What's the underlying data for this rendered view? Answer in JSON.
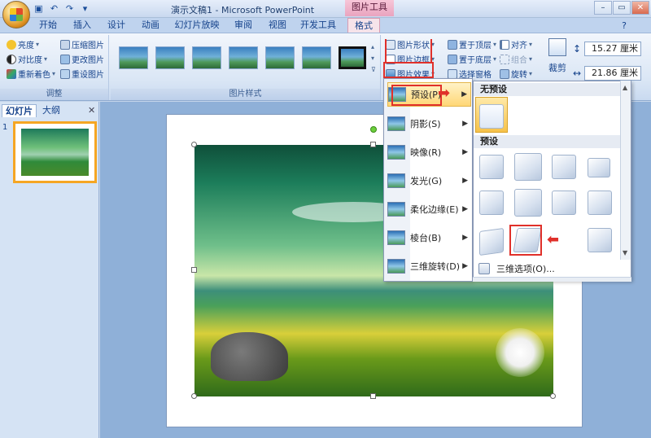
{
  "window": {
    "title": "演示文稿1 - Microsoft PowerPoint",
    "tools_title": "图片工具"
  },
  "tabs": [
    "开始",
    "插入",
    "设计",
    "动画",
    "幻灯片放映",
    "审阅",
    "视图",
    "开发工具",
    "格式"
  ],
  "ribbon": {
    "adjust": {
      "label": "调整",
      "items": [
        "亮度",
        "对比度",
        "重新着色",
        "压缩图片",
        "更改图片",
        "重设图片"
      ]
    },
    "picture_styles": {
      "label": "图片样式",
      "shape": "图片形状",
      "border": "图片边框",
      "effects": "图片效果"
    },
    "arrange": {
      "items": [
        "置于顶层",
        "置于底层",
        "选择窗格",
        "对齐",
        "组合",
        "旋转"
      ]
    },
    "size": {
      "crop": "裁剪",
      "height": "15.27 厘米",
      "width": "21.86 厘米"
    }
  },
  "left_pane": {
    "tabs": [
      "幻灯片",
      "大纲"
    ],
    "slide_number": "1"
  },
  "menu": {
    "items": [
      {
        "label": "预设(P)"
      },
      {
        "label": "阴影(S)"
      },
      {
        "label": "映像(R)"
      },
      {
        "label": "发光(G)"
      },
      {
        "label": "柔化边缘(E)"
      },
      {
        "label": "棱台(B)"
      },
      {
        "label": "三维旋转(D)"
      }
    ]
  },
  "submenu": {
    "no_preset_header": "无预设",
    "preset_header": "预设",
    "footer": "三维选项(O)..."
  },
  "colors": {
    "highlight_outline": "#e0302a",
    "active_tab": "#f6e3ea"
  }
}
